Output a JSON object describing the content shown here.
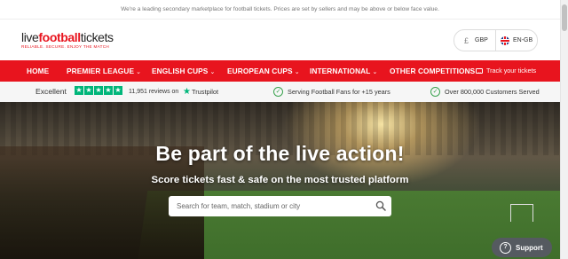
{
  "notice": "We're a leading secondary marketplace for football tickets. Prices are set by sellers and may be above or below face value.",
  "logo": {
    "part1": "live",
    "part2": "football",
    "part3": "tickets",
    "tagline": "RELIABLE. SECURE. ENJOY THE MATCH"
  },
  "locale": {
    "currency_symbol": "£",
    "currency": "GBP",
    "language": "EN-GB"
  },
  "nav": {
    "items": [
      {
        "label": "HOME",
        "chevron": ""
      },
      {
        "label": "PREMIER LEAGUE",
        "chevron": "⌄"
      },
      {
        "label": "ENGLISH CUPS",
        "chevron": "⌄"
      },
      {
        "label": "EUROPEAN CUPS",
        "chevron": "⌄"
      },
      {
        "label": "INTERNATIONAL",
        "chevron": "⌄"
      },
      {
        "label": "OTHER COMPETITIONS",
        "chevron": "⌄"
      }
    ],
    "track": "Track your tickets"
  },
  "trust": {
    "rating": "Excellent",
    "reviews": "11,951 reviews on",
    "trustpilot": "Trustpilot",
    "features": [
      "Serving Football Fans for +15 years",
      "Over 800,000 Customers Served"
    ]
  },
  "hero": {
    "title": "Be part of the live action!",
    "subtitle": "Score tickets fast & safe on the most trusted platform",
    "search_placeholder": "Search for team, match, stadium or city"
  },
  "support": {
    "label": "Support"
  },
  "colors": {
    "brand_red": "#e8141e",
    "trustpilot_green": "#00b67a",
    "check_green": "#3aa34f"
  }
}
